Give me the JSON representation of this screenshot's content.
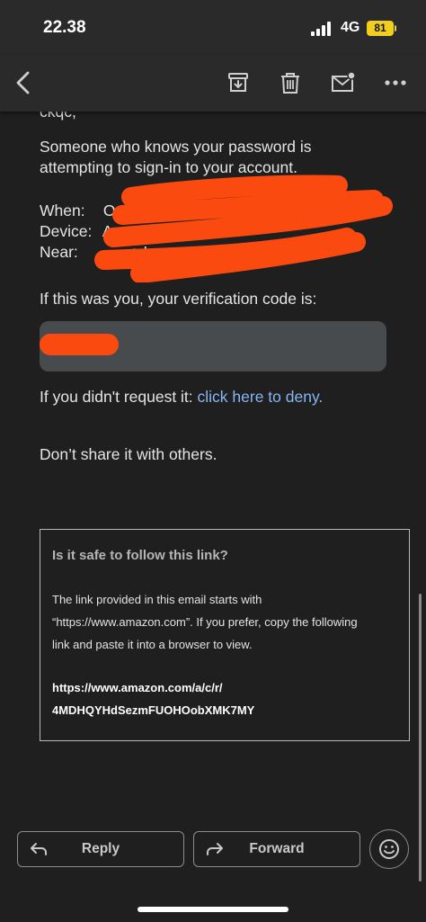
{
  "status": {
    "time": "22.38",
    "network": "4G",
    "battery": "81"
  },
  "toolbar": {
    "back_icon": "chevron-left-icon",
    "archive_icon": "archive-icon",
    "delete_icon": "trash-icon",
    "unread_icon": "mail-unread-icon",
    "more_icon": "more-horizontal-icon"
  },
  "email": {
    "cut_line": "ckqc,",
    "intro": [
      "Someone who knows your password is",
      "attempting to sign-in to your account."
    ],
    "when_label": "When:",
    "when_value": "Oc",
    "device_label": "Device:",
    "device_value": "A",
    "near_label": "Near:",
    "near_value": "a Lump",
    "verify_text": "If this was you, your verification code is:",
    "deny_prefix": "If you didn't request it: ",
    "deny_link": "click here to deny.",
    "share_warning": "Don’t share it with others."
  },
  "safe_link": {
    "title": "Is it safe to follow this link?",
    "lines": [
      "The link provided in this email starts with",
      "“https://www.amazon.com”. If you prefer, copy the following",
      "link and paste it into a browser to view."
    ],
    "url_lines": [
      "https://www.amazon.com/a/c/r/",
      "4MDHQYHdSezmFUOHOobXMK7MY"
    ]
  },
  "actions": {
    "reply_label": "Reply",
    "forward_label": "Forward",
    "emoji_icon": "smiley-icon"
  },
  "colors": {
    "background": "#1f1f1f",
    "link": "#86b6f3",
    "redaction": "#fb4a0f",
    "battery": "#f2cf1e"
  }
}
